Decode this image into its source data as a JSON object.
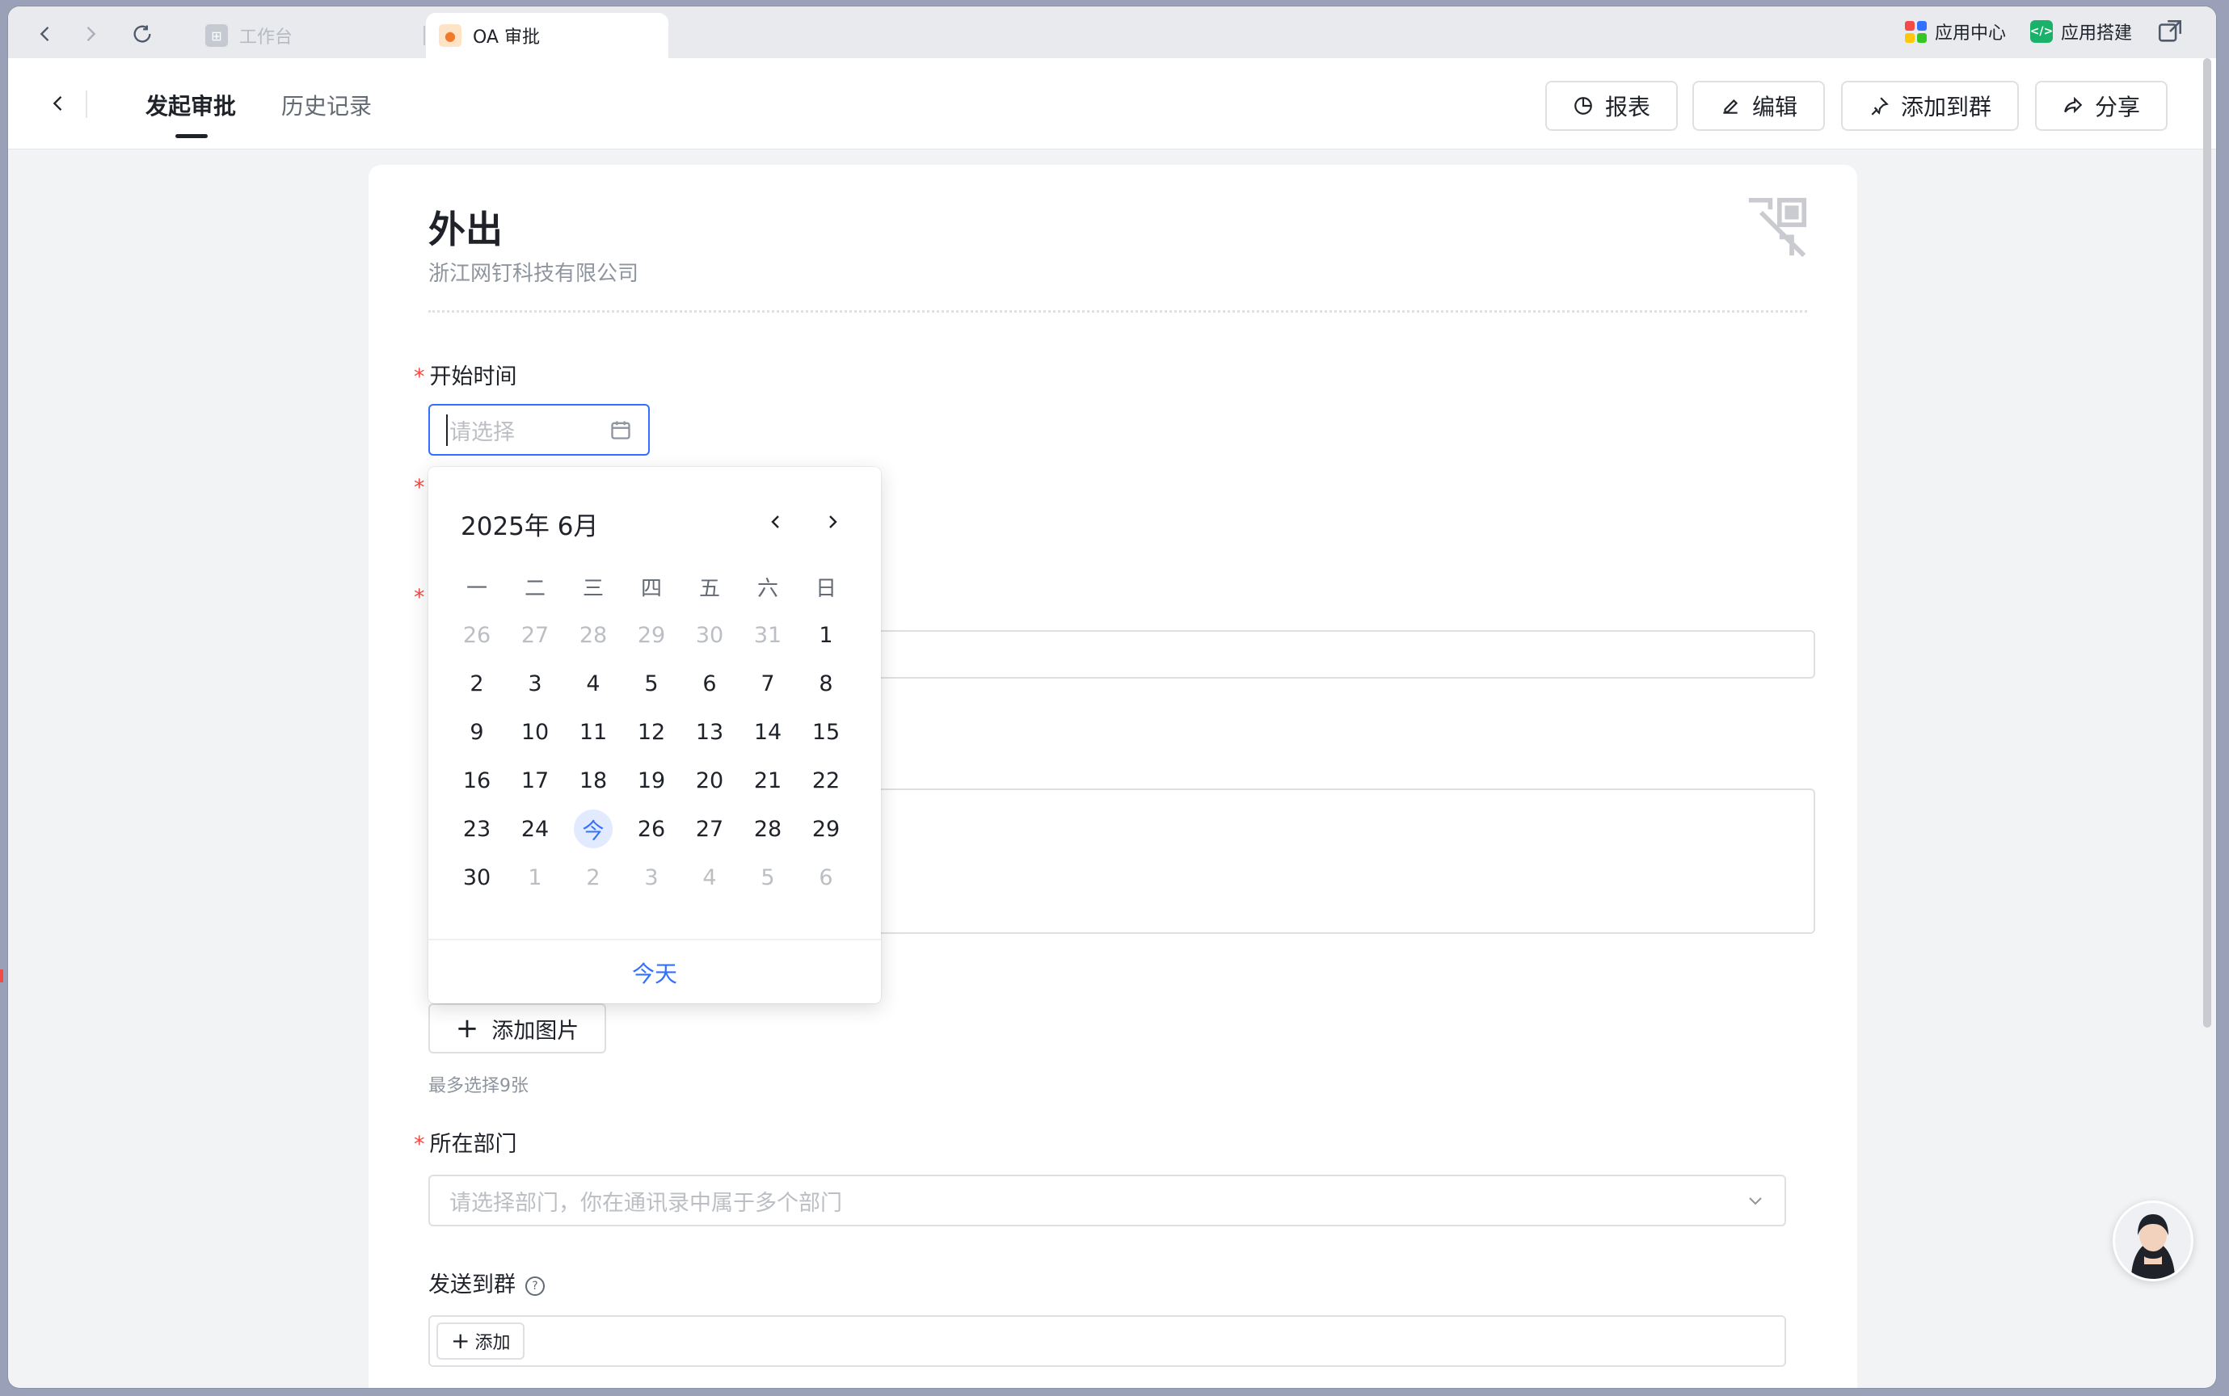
{
  "tabbar": {
    "inactive_tab": "工作台",
    "active_tab": "OA 审批",
    "app_center": "应用中心",
    "app_builder": "应用搭建"
  },
  "header": {
    "tab_start": "发起审批",
    "tab_history": "历史记录",
    "btn_report": "报表",
    "btn_edit": "编辑",
    "btn_add_group": "添加到群",
    "btn_share": "分享"
  },
  "form": {
    "title": "外出",
    "company": "浙江网钉科技有限公司",
    "start_time_label": "开始时间",
    "start_time_placeholder": "请选择",
    "add_image": "添加图片",
    "image_hint": "最多选择9张",
    "dept_label": "所在部门",
    "dept_placeholder": "请选择部门，你在通讯录中属于多个部门",
    "send_group_label": "发送到群",
    "send_group_add": "添加"
  },
  "calendar": {
    "title": "2025年 6月",
    "weekdays": [
      "一",
      "二",
      "三",
      "四",
      "五",
      "六",
      "日"
    ],
    "weeks": [
      [
        {
          "d": "26",
          "m": true
        },
        {
          "d": "27",
          "m": true
        },
        {
          "d": "28",
          "m": true
        },
        {
          "d": "29",
          "m": true
        },
        {
          "d": "30",
          "m": true
        },
        {
          "d": "31",
          "m": true
        },
        {
          "d": "1"
        }
      ],
      [
        {
          "d": "2"
        },
        {
          "d": "3"
        },
        {
          "d": "4"
        },
        {
          "d": "5"
        },
        {
          "d": "6"
        },
        {
          "d": "7"
        },
        {
          "d": "8"
        }
      ],
      [
        {
          "d": "9"
        },
        {
          "d": "10"
        },
        {
          "d": "11"
        },
        {
          "d": "12"
        },
        {
          "d": "13"
        },
        {
          "d": "14"
        },
        {
          "d": "15"
        }
      ],
      [
        {
          "d": "16"
        },
        {
          "d": "17"
        },
        {
          "d": "18"
        },
        {
          "d": "19"
        },
        {
          "d": "20"
        },
        {
          "d": "21"
        },
        {
          "d": "22"
        }
      ],
      [
        {
          "d": "23"
        },
        {
          "d": "24"
        },
        {
          "d": "今",
          "today": true
        },
        {
          "d": "26"
        },
        {
          "d": "27"
        },
        {
          "d": "28"
        },
        {
          "d": "29"
        }
      ],
      [
        {
          "d": "30"
        },
        {
          "d": "1",
          "m": true
        },
        {
          "d": "2",
          "m": true
        },
        {
          "d": "3",
          "m": true
        },
        {
          "d": "4",
          "m": true
        },
        {
          "d": "5",
          "m": true
        },
        {
          "d": "6",
          "m": true
        }
      ]
    ],
    "today_button": "今天"
  },
  "colors": {
    "accent": "#3370ff",
    "required": "#f54a45",
    "app_builder": "#1ab26b"
  }
}
